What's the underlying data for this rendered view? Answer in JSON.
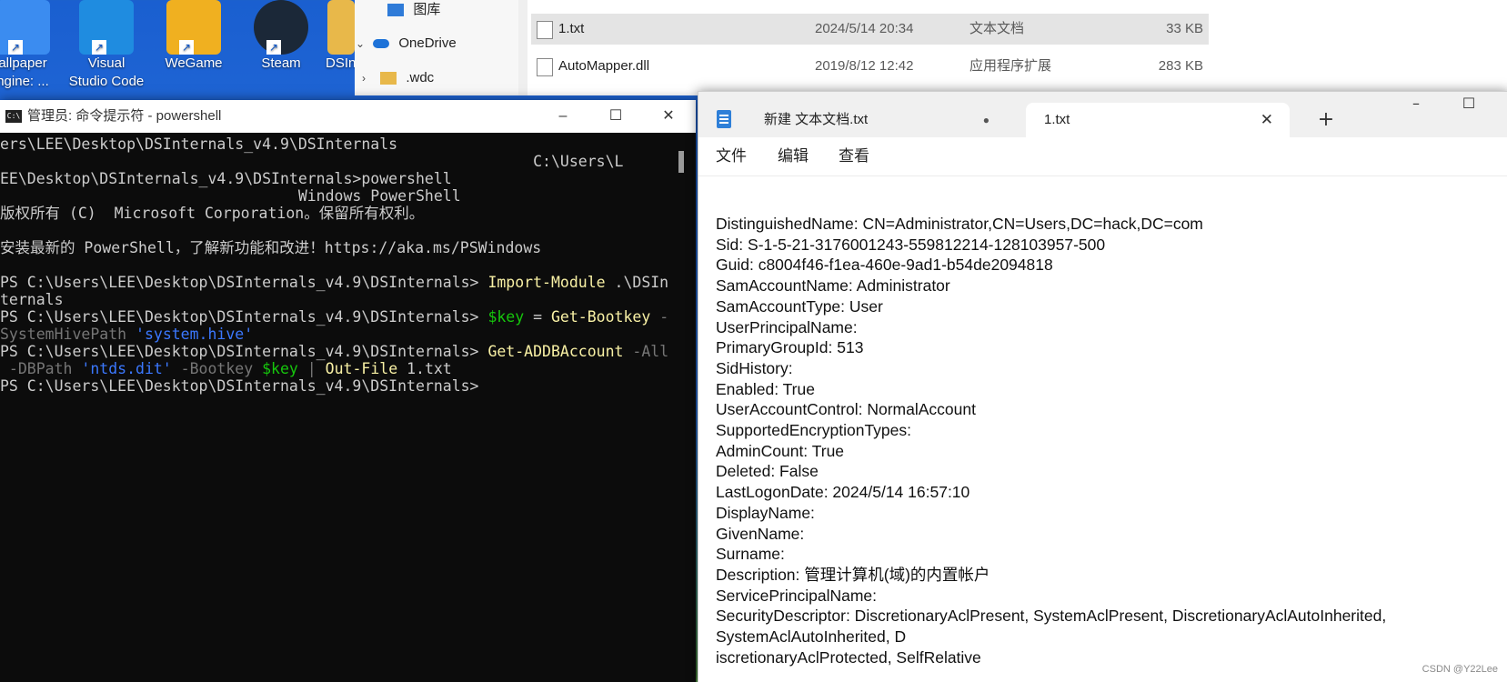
{
  "desktop": {
    "icons": [
      {
        "line1": "allpaper",
        "line2": "ngine: ...",
        "icon": "wallpaper-engine-icon"
      },
      {
        "line1": "Visual",
        "line2": "Studio Code",
        "icon": "vscode-icon"
      },
      {
        "line1": "WeGame",
        "line2": "",
        "icon": "wegame-icon"
      },
      {
        "line1": "Steam",
        "line2": "",
        "icon": "steam-icon"
      },
      {
        "line1": "DSIn",
        "line2": "",
        "icon": "folder-icon"
      }
    ]
  },
  "explorer": {
    "nav": [
      {
        "label": "图库",
        "chevron": "",
        "icon": "gallery-icon"
      },
      {
        "label": "OneDrive",
        "chevron": "⌄",
        "icon": "onedrive-icon"
      },
      {
        "label": ".wdc",
        "chevron": "›",
        "icon": "folder-icon"
      }
    ],
    "files": [
      {
        "name": "1.txt",
        "date": "2024/5/14 20:34",
        "type": "文本文档",
        "size": "33 KB",
        "selected": true
      },
      {
        "name": "AutoMapper.dll",
        "date": "2019/8/12 12:42",
        "type": "应用程序扩展",
        "size": "283 KB",
        "selected": false
      }
    ]
  },
  "terminal": {
    "title": "管理员: 命令提示符 - powershell",
    "lines": [
      [
        {
          "t": "ers\\LEE\\Desktop\\DSInternals_v4.9\\DSInternals",
          "c": ""
        }
      ],
      [
        {
          "t": "                                                           C:\\Users\\L",
          "c": ""
        }
      ],
      [
        {
          "t": "EE\\Desktop\\DSInternals_v4.9\\DSInternals>powershell",
          "c": ""
        }
      ],
      [
        {
          "t": "                                 Windows PowerShell",
          "c": ""
        }
      ],
      [
        {
          "t": "版权所有 (C)  Microsoft Corporation。保留所有权利。",
          "c": ""
        }
      ],
      [
        {
          "t": "",
          "c": ""
        }
      ],
      [
        {
          "t": "安装最新的 PowerShell，了解新功能和改进！https://aka.ms/PSWindows",
          "c": ""
        }
      ],
      [
        {
          "t": "",
          "c": ""
        }
      ],
      [
        {
          "t": "PS C:\\Users\\LEE\\Desktop\\DSInternals_v4.9\\DSInternals> ",
          "c": ""
        },
        {
          "t": "Import-Module",
          "c": "c-yel"
        },
        {
          "t": " .\\DSIn",
          "c": ""
        }
      ],
      [
        {
          "t": "ternals",
          "c": ""
        }
      ],
      [
        {
          "t": "PS C:\\Users\\LEE\\Desktop\\DSInternals_v4.9\\DSInternals> ",
          "c": ""
        },
        {
          "t": "$key",
          "c": "c-grn"
        },
        {
          "t": " = ",
          "c": ""
        },
        {
          "t": "Get-Bootkey",
          "c": "c-yel"
        },
        {
          "t": " -",
          "c": "c-gry"
        }
      ],
      [
        {
          "t": "SystemHivePath ",
          "c": "c-gry"
        },
        {
          "t": "'system.hive'",
          "c": "c-blu"
        }
      ],
      [
        {
          "t": "PS C:\\Users\\LEE\\Desktop\\DSInternals_v4.9\\DSInternals> ",
          "c": ""
        },
        {
          "t": "Get-ADDBAccount",
          "c": "c-yel"
        },
        {
          "t": " -All",
          "c": "c-gry"
        }
      ],
      [
        {
          "t": " -DBPath ",
          "c": "c-gry"
        },
        {
          "t": "'ntds.dit'",
          "c": "c-blu"
        },
        {
          "t": " -Bootkey ",
          "c": "c-gry"
        },
        {
          "t": "$key",
          "c": "c-grn"
        },
        {
          "t": " | ",
          "c": "c-gry"
        },
        {
          "t": "Out-File",
          "c": "c-yel"
        },
        {
          "t": " 1.txt",
          "c": ""
        }
      ],
      [
        {
          "t": "PS C:\\Users\\LEE\\Desktop\\DSInternals_v4.9\\DSInternals>",
          "c": ""
        }
      ]
    ]
  },
  "notepad": {
    "tabs": {
      "inactive": "新建 文本文档.txt",
      "inactive_dot": "●",
      "active": "1.txt",
      "close": "✕",
      "new": "+"
    },
    "menu": {
      "file": "文件",
      "edit": "编辑",
      "view": "查看"
    },
    "lines": [
      "DistinguishedName: CN=Administrator,CN=Users,DC=hack,DC=com",
      "Sid: S-1-5-21-3176001243-559812214-128103957-500",
      "Guid: c8004f46-f1ea-460e-9ad1-b54de2094818",
      "SamAccountName: Administrator",
      "SamAccountType: User",
      "UserPrincipalName:",
      "PrimaryGroupId: 513",
      "SidHistory:",
      "Enabled: True",
      "UserAccountControl: NormalAccount",
      "SupportedEncryptionTypes:",
      "AdminCount: True",
      "Deleted: False",
      "LastLogonDate: 2024/5/14 16:57:10",
      "DisplayName:",
      "GivenName:",
      "Surname:",
      "Description: 管理计算机(域)的内置帐户",
      "ServicePrincipalName:",
      "SecurityDescriptor: DiscretionaryAclPresent, SystemAclPresent, DiscretionaryAclAutoInherited,",
      "SystemAclAutoInherited, D",
      "iscretionaryAclProtected, SelfRelative"
    ]
  },
  "watermark": "CSDN @Y22Lee"
}
